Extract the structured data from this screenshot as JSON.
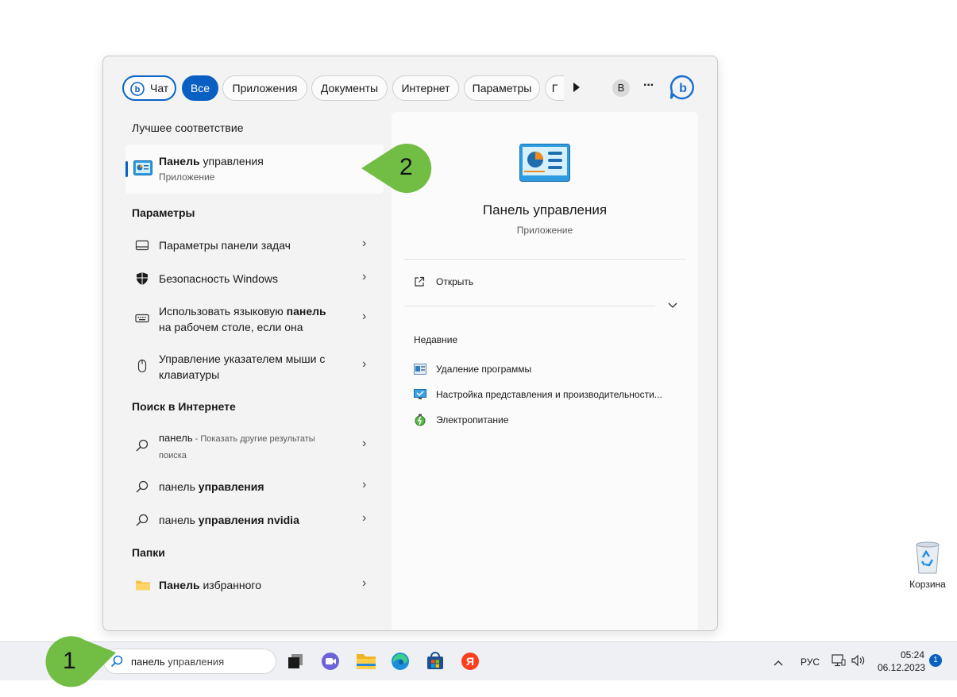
{
  "filters": {
    "chat": "Чат",
    "all": "Все",
    "apps": "Приложения",
    "docs": "Документы",
    "internet": "Интернет",
    "settings": "Параметры",
    "truncated": "Г",
    "avatar": "В",
    "more": "···"
  },
  "best_match": {
    "heading": "Лучшее соответствие",
    "title_bold": "Панель",
    "title_rest": " управления",
    "subtitle": "Приложение"
  },
  "settings_section": {
    "heading": "Параметры",
    "items": [
      {
        "text": "Параметры панели задач"
      },
      {
        "text": "Безопасность Windows"
      },
      {
        "line1_a": "Использовать языковую ",
        "line1_b": "панель",
        "line2": "на рабочем столе, если она"
      },
      {
        "line1": "Управление указателем мыши с",
        "line2": "клавиатуры"
      }
    ]
  },
  "web_section": {
    "heading": "Поиск в Интернете",
    "items": [
      {
        "a": "панель",
        "b": " - Показать другие результаты",
        "c": "поиска"
      },
      {
        "a": "панель ",
        "b": "управления"
      },
      {
        "a": "панель ",
        "b": "управления nvidia"
      }
    ]
  },
  "folders_section": {
    "heading": "Папки",
    "items": [
      {
        "a": "Панель",
        "b": " избранного"
      }
    ]
  },
  "detail": {
    "title": "Панель управления",
    "subtitle": "Приложение",
    "open": "Открыть",
    "recent_heading": "Недавние",
    "recent": [
      "Удаление программы",
      "Настройка представления и производительности...",
      "Электропитание"
    ]
  },
  "callouts": {
    "one": "1",
    "two": "2"
  },
  "taskbar": {
    "search_bold": "панель",
    "search_rest": " управления",
    "lang": "РУС",
    "time": "05:24",
    "date": "06.12.2023",
    "notif_count": "1"
  },
  "desktop": {
    "recycle_bin": "Корзина"
  },
  "colors": {
    "accent": "#0a5fc2",
    "callout": "#72bd44"
  }
}
